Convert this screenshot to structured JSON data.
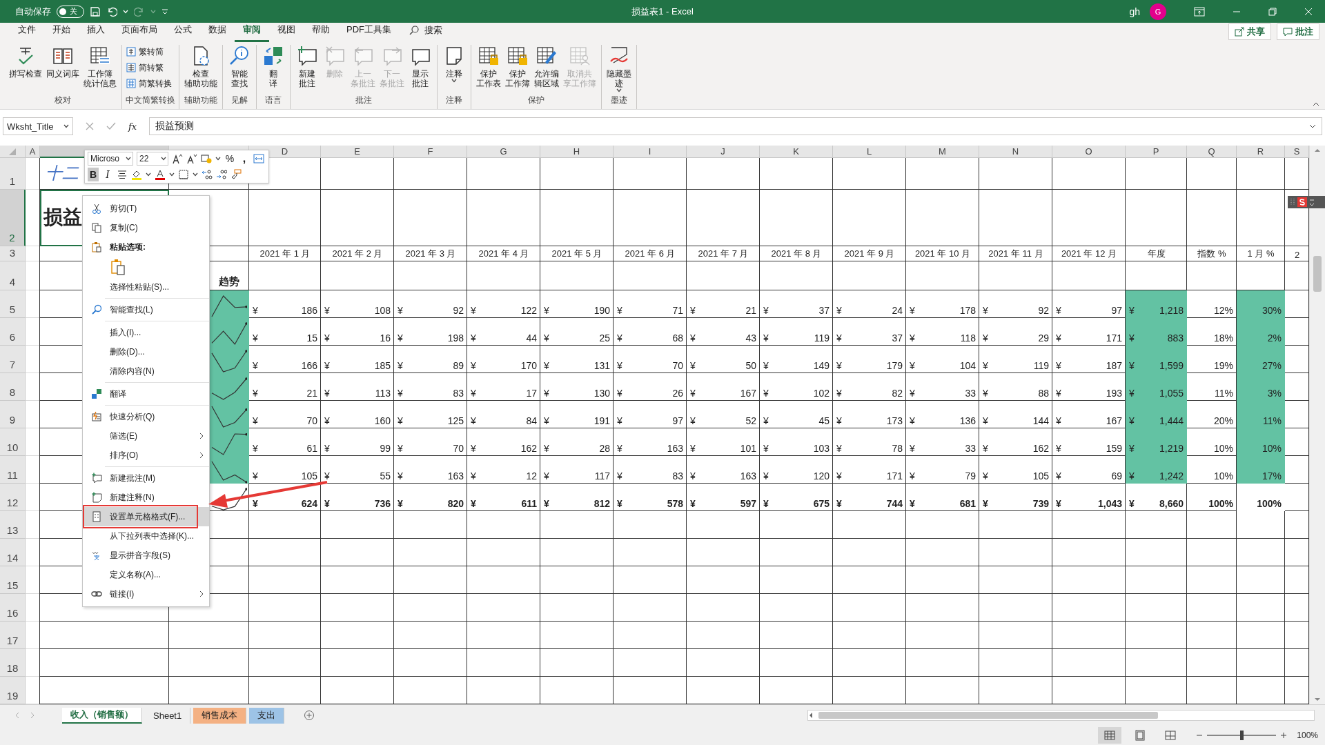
{
  "title_bar": {
    "autosave_label": "自动保存",
    "autosave_on": false,
    "autosave_state": "关",
    "title": "损益表1  -  Excel",
    "user": "gh",
    "avatar": "G"
  },
  "menu_tabs": [
    {
      "label": "文件",
      "selected": false
    },
    {
      "label": "开始",
      "selected": false
    },
    {
      "label": "插入",
      "selected": false
    },
    {
      "label": "页面布局",
      "selected": false
    },
    {
      "label": "公式",
      "selected": false
    },
    {
      "label": "数据",
      "selected": false
    },
    {
      "label": "审阅",
      "selected": true
    },
    {
      "label": "视图",
      "selected": false
    },
    {
      "label": "帮助",
      "selected": false
    },
    {
      "label": "PDF工具集",
      "selected": false
    }
  ],
  "search": {
    "label": "搜索"
  },
  "share_button": "共享",
  "comments_button": "批注",
  "ribbon_groups": [
    {
      "label": "校对",
      "kind": "large",
      "buttons": [
        {
          "kind": "spelling",
          "lines": [
            "拼写检查"
          ],
          "disabled": false,
          "dropdown": false
        },
        {
          "kind": "thesaurus",
          "lines": [
            "同义词库"
          ],
          "disabled": false,
          "dropdown": false
        },
        {
          "kind": "stats",
          "lines": [
            "工作簿",
            "统计信息"
          ],
          "disabled": false,
          "dropdown": false
        }
      ]
    },
    {
      "label": "中文简繁转换",
      "kind": "stack",
      "buttons": [
        {
          "kind": "to_simplified",
          "lines": [
            "繁转简"
          ],
          "disabled": false,
          "dropdown": false
        },
        {
          "kind": "to_traditional",
          "lines": [
            "简转繁"
          ],
          "disabled": false,
          "dropdown": false
        },
        {
          "kind": "convert",
          "lines": [
            "简繁转换"
          ],
          "disabled": false,
          "dropdown": false
        }
      ]
    },
    {
      "label": "辅助功能",
      "kind": "large",
      "buttons": [
        {
          "kind": "accessibility",
          "lines": [
            "检查",
            "辅助功能"
          ],
          "disabled": false,
          "dropdown": false
        }
      ]
    },
    {
      "label": "见解",
      "kind": "large",
      "buttons": [
        {
          "kind": "smart_lookup",
          "lines": [
            "智能",
            "查找"
          ],
          "disabled": false,
          "dropdown": false
        }
      ]
    },
    {
      "label": "语言",
      "kind": "large",
      "buttons": [
        {
          "kind": "translate",
          "lines": [
            "翻",
            "译"
          ],
          "disabled": false,
          "dropdown": false
        }
      ]
    },
    {
      "label": "批注",
      "kind": "large",
      "buttons": [
        {
          "kind": "new_comment",
          "lines": [
            "新建",
            "批注"
          ],
          "disabled": false,
          "dropdown": false
        },
        {
          "kind": "delete_comment",
          "lines": [
            "删除"
          ],
          "disabled": true,
          "dropdown": false
        },
        {
          "kind": "previous_comment",
          "lines": [
            "上一",
            "条批注"
          ],
          "disabled": true,
          "dropdown": false
        },
        {
          "kind": "next_comment",
          "lines": [
            "下一",
            "条批注"
          ],
          "disabled": true,
          "dropdown": false
        },
        {
          "kind": "show_comments",
          "lines": [
            "显示",
            "批注"
          ],
          "disabled": false,
          "dropdown": false
        }
      ]
    },
    {
      "label": "注释",
      "kind": "large",
      "buttons": [
        {
          "kind": "note",
          "lines": [
            "注释"
          ],
          "disabled": false,
          "dropdown": true
        }
      ]
    },
    {
      "label": "保护",
      "kind": "large",
      "buttons": [
        {
          "kind": "protect_sheet",
          "lines": [
            "保护",
            "工作表"
          ],
          "disabled": false,
          "dropdown": false
        },
        {
          "kind": "protect_workbook",
          "lines": [
            "保护",
            "工作簿"
          ],
          "disabled": false,
          "dropdown": false
        },
        {
          "kind": "allow_edit",
          "lines": [
            "允许编",
            "辑区域"
          ],
          "disabled": false,
          "dropdown": false
        },
        {
          "kind": "unshare",
          "lines": [
            "取消共",
            "享工作簿"
          ],
          "disabled": true,
          "dropdown": false
        }
      ]
    },
    {
      "label": "墨迹",
      "kind": "large",
      "buttons": [
        {
          "kind": "ink",
          "lines": [
            "隐藏墨",
            "迹"
          ],
          "disabled": false,
          "dropdown": true
        }
      ]
    }
  ],
  "formula_bar": {
    "name_box": "Wksht_Title",
    "function_label": "fx",
    "value": "损益预测"
  },
  "grid": {
    "columns": [
      {
        "label": "A",
        "selected": false
      },
      {
        "selected": true
      },
      {
        "selected": false
      },
      {
        "label": "D",
        "selected": false
      },
      {
        "label": "E",
        "selected": false
      },
      {
        "label": "F",
        "selected": false
      },
      {
        "label": "G",
        "selected": false
      },
      {
        "label": "H",
        "selected": false
      },
      {
        "label": "I",
        "selected": false
      },
      {
        "label": "J",
        "selected": false
      },
      {
        "label": "K",
        "selected": false
      },
      {
        "label": "L",
        "selected": false
      },
      {
        "label": "M",
        "selected": false
      },
      {
        "label": "N",
        "selected": false
      },
      {
        "label": "O",
        "selected": false
      },
      {
        "label": "P",
        "selected": false
      },
      {
        "label": "Q",
        "selected": false
      },
      {
        "label": "R",
        "selected": false
      },
      {
        "label": "S",
        "selected": false
      }
    ],
    "rows": [
      {
        "label": "1",
        "selected": false
      },
      {
        "label": "2",
        "selected": true
      },
      {
        "label": "3",
        "selected": false
      },
      {
        "label": "4",
        "selected": false
      },
      {
        "label": "5",
        "selected": false
      },
      {
        "label": "6",
        "selected": false
      },
      {
        "label": "7",
        "selected": false
      },
      {
        "label": "8",
        "selected": false
      },
      {
        "label": "9",
        "selected": false
      },
      {
        "label": "10",
        "selected": false
      },
      {
        "label": "11",
        "selected": false
      },
      {
        "label": "12",
        "selected": false
      },
      {
        "label": "13",
        "selected": false
      },
      {
        "label": "14",
        "selected": false
      },
      {
        "label": "15",
        "selected": false
      },
      {
        "label": "16",
        "selected": false
      },
      {
        "label": "17",
        "selected": false
      },
      {
        "label": "18",
        "selected": false
      },
      {
        "label": "19",
        "selected": false
      }
    ],
    "title_cell": "十二",
    "heading_cell": "损益",
    "trend_header": "趋势",
    "month_headers": [
      "2021 年 1 月",
      "2021 年 2 月",
      "2021 年 3 月",
      "2021 年 4 月",
      "2021 年 5 月",
      "2021 年 6 月",
      "2021 年 7 月",
      "2021 年 8 月",
      "2021 年 9 月",
      "2021 年 10 月",
      "2021 年 11 月",
      "2021 年 12 月"
    ],
    "summary_headers": [
      "年度",
      "指数 %",
      "1 月 %",
      "2"
    ],
    "data_rows": [
      {
        "kind": "data",
        "trend_highlighted": true,
        "months": [
          {
            "symbol": "¥",
            "amount": "186"
          },
          {
            "symbol": "¥",
            "amount": "108"
          },
          {
            "symbol": "¥",
            "amount": "92"
          },
          {
            "symbol": "¥",
            "amount": "122"
          },
          {
            "symbol": "¥",
            "amount": "190"
          },
          {
            "symbol": "¥",
            "amount": "71"
          },
          {
            "symbol": "¥",
            "amount": "21"
          },
          {
            "symbol": "¥",
            "amount": "37"
          },
          {
            "symbol": "¥",
            "amount": "24"
          },
          {
            "symbol": "¥",
            "amount": "178"
          },
          {
            "symbol": "¥",
            "amount": "92"
          },
          {
            "symbol": "¥",
            "amount": "97"
          }
        ],
        "annual": {
          "symbol": "¥",
          "amount": "1,218",
          "highlighted": true
        },
        "index_pct": "12%",
        "jan_pct": {
          "text": "30%",
          "highlighted": true
        }
      },
      {
        "kind": "data",
        "trend_highlighted": true,
        "months": [
          {
            "symbol": "¥",
            "amount": "15"
          },
          {
            "symbol": "¥",
            "amount": "16"
          },
          {
            "symbol": "¥",
            "amount": "198"
          },
          {
            "symbol": "¥",
            "amount": "44"
          },
          {
            "symbol": "¥",
            "amount": "25"
          },
          {
            "symbol": "¥",
            "amount": "68"
          },
          {
            "symbol": "¥",
            "amount": "43"
          },
          {
            "symbol": "¥",
            "amount": "119"
          },
          {
            "symbol": "¥",
            "amount": "37"
          },
          {
            "symbol": "¥",
            "amount": "118"
          },
          {
            "symbol": "¥",
            "amount": "29"
          },
          {
            "symbol": "¥",
            "amount": "171"
          }
        ],
        "annual": {
          "symbol": "¥",
          "amount": "883",
          "highlighted": true
        },
        "index_pct": "18%",
        "jan_pct": {
          "text": "2%",
          "highlighted": true
        }
      },
      {
        "kind": "data",
        "trend_highlighted": true,
        "months": [
          {
            "symbol": "¥",
            "amount": "166"
          },
          {
            "symbol": "¥",
            "amount": "185"
          },
          {
            "symbol": "¥",
            "amount": "89"
          },
          {
            "symbol": "¥",
            "amount": "170"
          },
          {
            "symbol": "¥",
            "amount": "131"
          },
          {
            "symbol": "¥",
            "amount": "70"
          },
          {
            "symbol": "¥",
            "amount": "50"
          },
          {
            "symbol": "¥",
            "amount": "149"
          },
          {
            "symbol": "¥",
            "amount": "179"
          },
          {
            "symbol": "¥",
            "amount": "104"
          },
          {
            "symbol": "¥",
            "amount": "119"
          },
          {
            "symbol": "¥",
            "amount": "187"
          }
        ],
        "annual": {
          "symbol": "¥",
          "amount": "1,599",
          "highlighted": true
        },
        "index_pct": "19%",
        "jan_pct": {
          "text": "27%",
          "highlighted": true
        }
      },
      {
        "kind": "data",
        "trend_highlighted": true,
        "months": [
          {
            "symbol": "¥",
            "amount": "21"
          },
          {
            "symbol": "¥",
            "amount": "113"
          },
          {
            "symbol": "¥",
            "amount": "83"
          },
          {
            "symbol": "¥",
            "amount": "17"
          },
          {
            "symbol": "¥",
            "amount": "130"
          },
          {
            "symbol": "¥",
            "amount": "26"
          },
          {
            "symbol": "¥",
            "amount": "167"
          },
          {
            "symbol": "¥",
            "amount": "102"
          },
          {
            "symbol": "¥",
            "amount": "82"
          },
          {
            "symbol": "¥",
            "amount": "33"
          },
          {
            "symbol": "¥",
            "amount": "88"
          },
          {
            "symbol": "¥",
            "amount": "193"
          }
        ],
        "annual": {
          "symbol": "¥",
          "amount": "1,055",
          "highlighted": true
        },
        "index_pct": "11%",
        "jan_pct": {
          "text": "3%",
          "highlighted": true
        }
      },
      {
        "kind": "data",
        "trend_highlighted": true,
        "months": [
          {
            "symbol": "¥",
            "amount": "70"
          },
          {
            "symbol": "¥",
            "amount": "160"
          },
          {
            "symbol": "¥",
            "amount": "125"
          },
          {
            "symbol": "¥",
            "amount": "84"
          },
          {
            "symbol": "¥",
            "amount": "191"
          },
          {
            "symbol": "¥",
            "amount": "97"
          },
          {
            "symbol": "¥",
            "amount": "52"
          },
          {
            "symbol": "¥",
            "amount": "45"
          },
          {
            "symbol": "¥",
            "amount": "173"
          },
          {
            "symbol": "¥",
            "amount": "136"
          },
          {
            "symbol": "¥",
            "amount": "144"
          },
          {
            "symbol": "¥",
            "amount": "167"
          }
        ],
        "annual": {
          "symbol": "¥",
          "amount": "1,444",
          "highlighted": true
        },
        "index_pct": "20%",
        "jan_pct": {
          "text": "11%",
          "highlighted": true
        }
      },
      {
        "kind": "data",
        "trend_highlighted": true,
        "months": [
          {
            "symbol": "¥",
            "amount": "61"
          },
          {
            "symbol": "¥",
            "amount": "99"
          },
          {
            "symbol": "¥",
            "amount": "70"
          },
          {
            "symbol": "¥",
            "amount": "162"
          },
          {
            "symbol": "¥",
            "amount": "28"
          },
          {
            "symbol": "¥",
            "amount": "163"
          },
          {
            "symbol": "¥",
            "amount": "101"
          },
          {
            "symbol": "¥",
            "amount": "103"
          },
          {
            "symbol": "¥",
            "amount": "78"
          },
          {
            "symbol": "¥",
            "amount": "33"
          },
          {
            "symbol": "¥",
            "amount": "162"
          },
          {
            "symbol": "¥",
            "amount": "159"
          }
        ],
        "annual": {
          "symbol": "¥",
          "amount": "1,219",
          "highlighted": true
        },
        "index_pct": "10%",
        "jan_pct": {
          "text": "10%",
          "highlighted": true
        }
      },
      {
        "kind": "data",
        "trend_highlighted": true,
        "months": [
          {
            "symbol": "¥",
            "amount": "105"
          },
          {
            "symbol": "¥",
            "amount": "55"
          },
          {
            "symbol": "¥",
            "amount": "163"
          },
          {
            "symbol": "¥",
            "amount": "12"
          },
          {
            "symbol": "¥",
            "amount": "117"
          },
          {
            "symbol": "¥",
            "amount": "83"
          },
          {
            "symbol": "¥",
            "amount": "163"
          },
          {
            "symbol": "¥",
            "amount": "120"
          },
          {
            "symbol": "¥",
            "amount": "171"
          },
          {
            "symbol": "¥",
            "amount": "79"
          },
          {
            "symbol": "¥",
            "amount": "105"
          },
          {
            "symbol": "¥",
            "amount": "69"
          }
        ],
        "annual": {
          "symbol": "¥",
          "amount": "1,242",
          "highlighted": true
        },
        "index_pct": "10%",
        "jan_pct": {
          "text": "17%",
          "highlighted": true
        }
      },
      {
        "kind": "total",
        "trend_highlighted": false,
        "months": [
          {
            "symbol": "¥",
            "amount": "624"
          },
          {
            "symbol": "¥",
            "amount": "736"
          },
          {
            "symbol": "¥",
            "amount": "820"
          },
          {
            "symbol": "¥",
            "amount": "611"
          },
          {
            "symbol": "¥",
            "amount": "812"
          },
          {
            "symbol": "¥",
            "amount": "578"
          },
          {
            "symbol": "¥",
            "amount": "597"
          },
          {
            "symbol": "¥",
            "amount": "675"
          },
          {
            "symbol": "¥",
            "amount": "744"
          },
          {
            "symbol": "¥",
            "amount": "681"
          },
          {
            "symbol": "¥",
            "amount": "739"
          },
          {
            "symbol": "¥",
            "amount": "1,043"
          }
        ],
        "annual": {
          "symbol": "¥",
          "amount": "8,660",
          "highlighted": false
        },
        "index_pct": "100%",
        "jan_pct": {
          "text": "100%",
          "highlighted": false
        }
      }
    ]
  },
  "mini_toolbar": {
    "font": "Microso",
    "size": "22",
    "bold": {
      "label": "B",
      "selected": true
    },
    "italic": {
      "label": "I",
      "selected": false
    },
    "percent": "%",
    "comma": ","
  },
  "context_menu": {
    "sections": [
      [
        {
          "kind": "cut",
          "label": "剪切(T)",
          "selected": false,
          "callout": false,
          "submenu": false
        },
        {
          "kind": "copy",
          "label": "复制(C)",
          "selected": false,
          "callout": false,
          "submenu": false
        },
        {
          "kind": "paste_header",
          "label": "粘贴选项:"
        },
        {
          "kind": "paste_option",
          "selected": false
        },
        {
          "kind": "plain",
          "label": "选择性粘贴(S)...",
          "selected": false,
          "callout": false,
          "submenu": false
        }
      ],
      [
        {
          "kind": "smart_lookup",
          "label": "智能查找(L)",
          "selected": false,
          "callout": false,
          "submenu": false
        }
      ],
      [
        {
          "kind": "plain",
          "label": "插入(I)...",
          "selected": false,
          "callout": false,
          "submenu": false
        },
        {
          "kind": "plain",
          "label": "删除(D)...",
          "selected": false,
          "callout": false,
          "submenu": false
        },
        {
          "kind": "plain",
          "label": "清除内容(N)",
          "selected": false,
          "callout": false,
          "submenu": false
        }
      ],
      [
        {
          "kind": "translate",
          "label": "翻译",
          "selected": false,
          "callout": false,
          "submenu": false
        }
      ],
      [
        {
          "kind": "quick_analysis",
          "label": "快速分析(Q)",
          "selected": false,
          "callout": false,
          "submenu": false
        },
        {
          "kind": "plain",
          "label": "筛选(E)",
          "selected": false,
          "callout": false,
          "submenu": true
        },
        {
          "kind": "plain",
          "label": "排序(O)",
          "selected": false,
          "callout": false,
          "submenu": true
        }
      ],
      [
        {
          "kind": "new_comment",
          "label": "新建批注(M)",
          "selected": false,
          "callout": false,
          "submenu": false
        },
        {
          "kind": "new_note",
          "label": "新建注释(N)",
          "selected": false,
          "callout": false,
          "submenu": false
        },
        {
          "kind": "format_cells",
          "label": "设置单元格格式(F)...",
          "selected": true,
          "callout": true,
          "submenu": false
        },
        {
          "kind": "plain",
          "label": "从下拉列表中选择(K)...",
          "selected": false,
          "callout": false,
          "submenu": false
        },
        {
          "kind": "pinyin",
          "label": "显示拼音字段(S)",
          "selected": false,
          "callout": false,
          "submenu": false
        },
        {
          "kind": "plain",
          "label": "定义名称(A)...",
          "selected": false,
          "callout": false,
          "submenu": false
        },
        {
          "kind": "link",
          "label": "链接(I)",
          "selected": false,
          "callout": false,
          "submenu": true
        }
      ]
    ]
  },
  "sheet_tabs": [
    {
      "label": "收入（销售额）",
      "selected": true
    },
    {
      "label": "Sheet1",
      "selected": false
    },
    {
      "label": "销售成本",
      "selected": false,
      "color": "#f4b183"
    },
    {
      "label": "支出",
      "selected": false,
      "color": "#9dc3e6"
    }
  ],
  "status_bar": {
    "views": [
      {
        "kind": "normal",
        "selected": true
      },
      {
        "kind": "page_layout",
        "selected": false
      },
      {
        "kind": "page_break",
        "selected": false
      }
    ],
    "zoom": {
      "level": 0.5,
      "reading": "100%"
    }
  }
}
